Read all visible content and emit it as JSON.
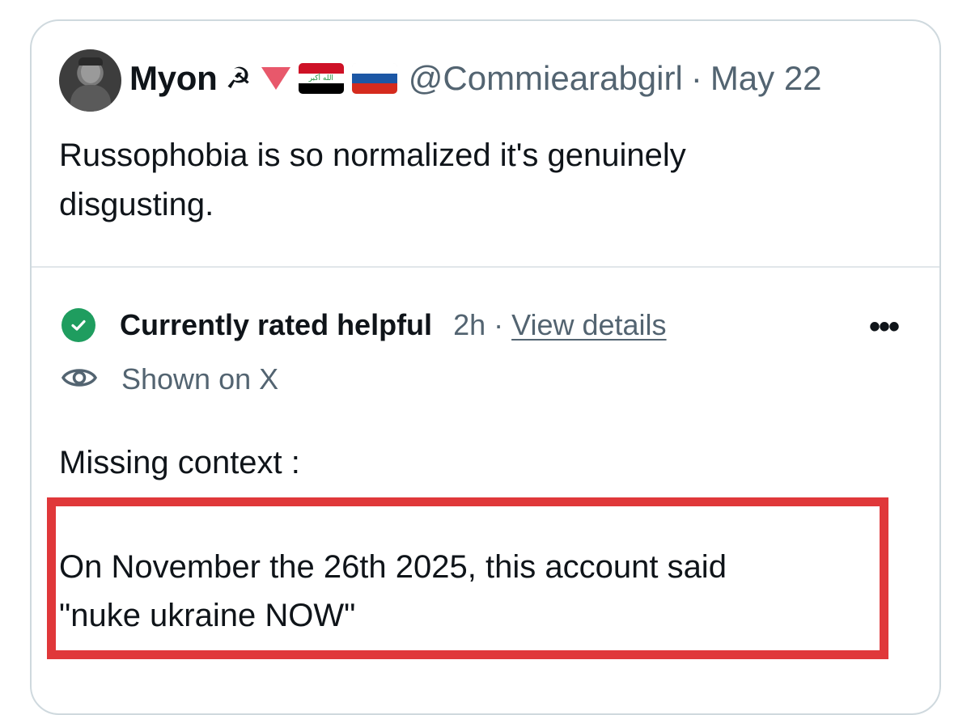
{
  "author": {
    "display_name": "Myon",
    "emoji_sickle": "☭",
    "handle": "@Commiearabgirl",
    "separator": "·",
    "date": "May 22",
    "flag_iraq_script": "الله أكبر"
  },
  "tweet": {
    "line1": "Russophobia is so normalized it's genuinely",
    "line2": "disgusting."
  },
  "note": {
    "status": "Currently rated helpful",
    "age": "2h",
    "separator": "·",
    "details_link": "View details",
    "shown_on": "Shown on X",
    "heading": "Missing context :",
    "line1": "On November the 26th 2025, this account said",
    "line2": "\"nuke ukraine NOW\"",
    "more_glyph": "•••"
  },
  "colors": {
    "accent_red": "#e0383a",
    "helpful_green": "#1f9d5f",
    "secondary_text": "#536471",
    "triangle_pink": "#e8586b"
  },
  "icons": {
    "status": "check-circle-icon",
    "visibility": "eye-icon",
    "more": "more-horizontal-icon"
  }
}
